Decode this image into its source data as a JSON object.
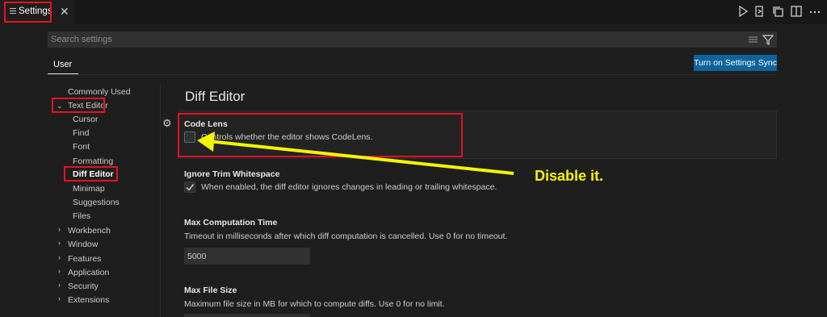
{
  "tab": {
    "label": "Settings",
    "close": "✕"
  },
  "search": {
    "placeholder": "Search settings"
  },
  "scope_tab": "User",
  "sync_button": "Turn on Settings Sync",
  "toc": {
    "commonly_used": "Commonly Used",
    "text_editor": "Text Editor",
    "children": [
      "Cursor",
      "Find",
      "Font",
      "Formatting",
      "Diff Editor",
      "Minimap",
      "Suggestions",
      "Files"
    ],
    "groups": [
      "Workbench",
      "Window",
      "Features",
      "Application",
      "Security",
      "Extensions"
    ]
  },
  "section_title": "Diff Editor",
  "settings": {
    "code_lens": {
      "title": "Code Lens",
      "desc": "Controls whether the editor shows CodeLens.",
      "checked": false
    },
    "ignore_trim": {
      "title": "Ignore Trim Whitespace",
      "desc": "When enabled, the diff editor ignores changes in leading or trailing whitespace.",
      "checked": true
    },
    "max_time": {
      "title": "Max Computation Time",
      "desc": "Timeout in milliseconds after which diff computation is cancelled. Use 0 for no timeout.",
      "value": "5000"
    },
    "max_size": {
      "title": "Max File Size",
      "desc": "Maximum file size in MB for which to compute diffs. Use 0 for no limit."
    }
  },
  "annotation": {
    "text": "Disable it.",
    "color": "#f5f500",
    "highlight_color": "#e81123"
  },
  "colors": {
    "background": "#1e1e1e",
    "accent": "#0e639c"
  }
}
